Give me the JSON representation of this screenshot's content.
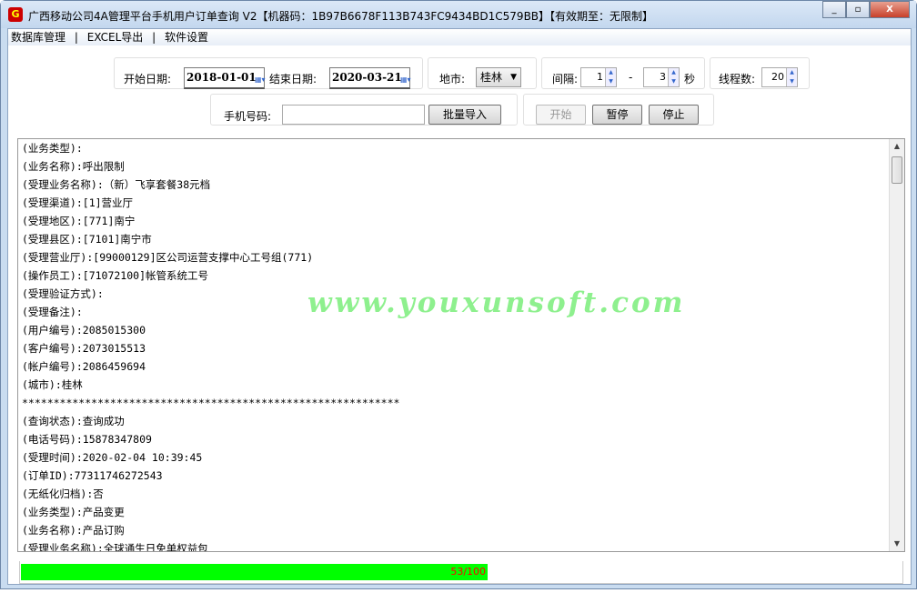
{
  "window": {
    "title": "广西移动公司4A管理平台手机用户订单查询 V2【机器码：1B97B6678F113B743FC9434BD1C579BB】【有效期至：无限制】",
    "icon_letter": "G"
  },
  "menu": [
    "数据库管理",
    "EXCEL导出",
    "软件设置"
  ],
  "menu_sep": "|",
  "controls": {
    "start_label": "开始日期:",
    "start_date": "2018-01-01",
    "end_label": "结束日期:",
    "end_date": "2020-03-21",
    "city_label": "地市:",
    "city": "桂林",
    "interval_label": "间隔:",
    "interval_min": "1",
    "interval_dash": "-",
    "interval_max": "3",
    "interval_unit": "秒",
    "threads_label": "线程数:",
    "threads": "20",
    "phone_label": "手机号码:",
    "phone_value": "",
    "import_btn": "批量导入",
    "start_btn": "开始",
    "pause_btn": "暂停",
    "stop_btn": "停止"
  },
  "log": [
    "(业务类型):",
    "(业务名称):呼出限制",
    "(受理业务名称):（新）飞享套餐38元档",
    "(受理渠道):[1]营业厅",
    "(受理地区):[771]南宁",
    "(受理县区):[7101]南宁市",
    "(受理营业厅):[99000129]区公司运营支撑中心工号组(771)",
    "(操作员工):[71072100]帐管系统工号",
    "(受理验证方式):",
    "(受理备注):",
    "(用户编号):2085015300",
    "(客户编号):2073015513",
    "(帐户编号):2086459694",
    "(城市):桂林",
    "************************************************************",
    "(查询状态):查询成功",
    "(电话号码):15878347809",
    "(受理时间):2020-02-04 10:39:45",
    "(订单ID):77311746272543",
    "(无纸化归档):否",
    "(业务类型):产品变更",
    "(业务名称):产品订购",
    "(受理业务名称):全球通生日免单权益包"
  ],
  "watermark": "www.youxunsoft.com",
  "progress": {
    "current": 53,
    "total": 100,
    "label": "53/100",
    "color": "#00ff00"
  }
}
